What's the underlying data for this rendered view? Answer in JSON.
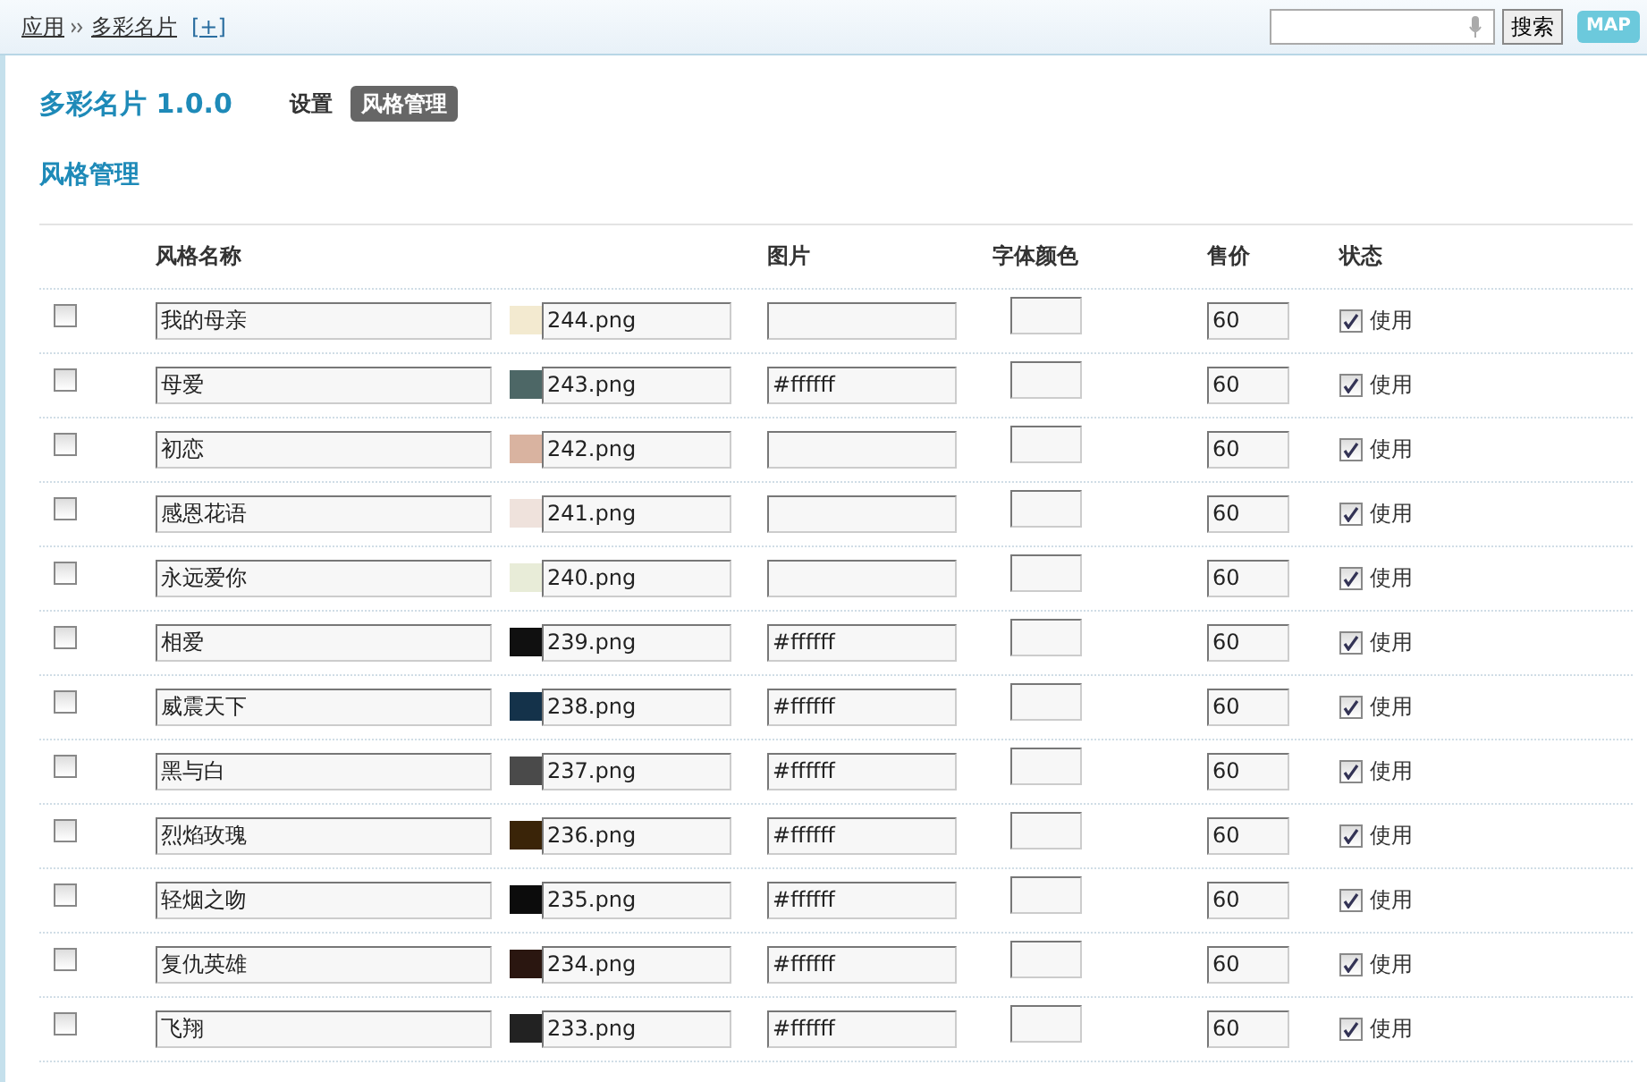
{
  "breadcrumb": {
    "items": [
      "应用",
      "多彩名片"
    ],
    "add_link": "[+]"
  },
  "search": {
    "button": "搜索",
    "map_button": "MAP"
  },
  "app": {
    "title": "多彩名片 1.0.0",
    "tabs": [
      {
        "label": "设置",
        "selected": false
      },
      {
        "label": "风格管理",
        "selected": true
      }
    ]
  },
  "section_title": "风格管理",
  "table": {
    "columns": [
      "风格名称",
      "图片",
      "字体颜色",
      "售价",
      "状态"
    ],
    "rows": [
      {
        "selected": false,
        "name": "我的母亲",
        "color": "#f3ead0",
        "image": "244.png",
        "price": "60",
        "enabled": true,
        "status": "使用"
      },
      {
        "selected": false,
        "name": "母爱",
        "color": "#4d6766",
        "image": "243.png",
        "font_color": "#ffffff",
        "price": "60",
        "enabled": true,
        "status": "使用"
      },
      {
        "selected": false,
        "name": "初恋",
        "color": "#d9b3a0",
        "image": "242.png",
        "price": "60",
        "enabled": true,
        "status": "使用"
      },
      {
        "selected": false,
        "name": "感恩花语",
        "color": "#efe2dc",
        "image": "241.png",
        "price": "60",
        "enabled": true,
        "status": "使用"
      },
      {
        "selected": false,
        "name": "永远爱你",
        "color": "#e8ecd8",
        "image": "240.png",
        "price": "60",
        "enabled": true,
        "status": "使用"
      },
      {
        "selected": false,
        "name": "相爱",
        "color": "#101010",
        "image": "239.png",
        "font_color": "#ffffff",
        "price": "60",
        "enabled": true,
        "status": "使用"
      },
      {
        "selected": false,
        "name": "威震天下",
        "color": "#14324a",
        "image": "238.png",
        "font_color": "#ffffff",
        "price": "60",
        "enabled": true,
        "status": "使用"
      },
      {
        "selected": false,
        "name": "黑与白",
        "color": "#4a4a4a",
        "image": "237.png",
        "font_color": "#ffffff",
        "price": "60",
        "enabled": true,
        "status": "使用"
      },
      {
        "selected": false,
        "name": "烈焰玫瑰",
        "color": "#3a2408",
        "image": "236.png",
        "font_color": "#ffffff",
        "price": "60",
        "enabled": true,
        "status": "使用"
      },
      {
        "selected": false,
        "name": "轻烟之吻",
        "color": "#0c0c0c",
        "image": "235.png",
        "font_color": "#ffffff",
        "price": "60",
        "enabled": true,
        "status": "使用"
      },
      {
        "selected": false,
        "name": "复仇英雄",
        "color": "#2a1610",
        "image": "234.png",
        "font_color": "#ffffff",
        "price": "60",
        "enabled": true,
        "status": "使用"
      },
      {
        "selected": false,
        "name": "飞翔",
        "color": "#222222",
        "image": "233.png",
        "font_color": "#ffffff",
        "price": "60",
        "enabled": true,
        "status": "使用"
      }
    ]
  }
}
